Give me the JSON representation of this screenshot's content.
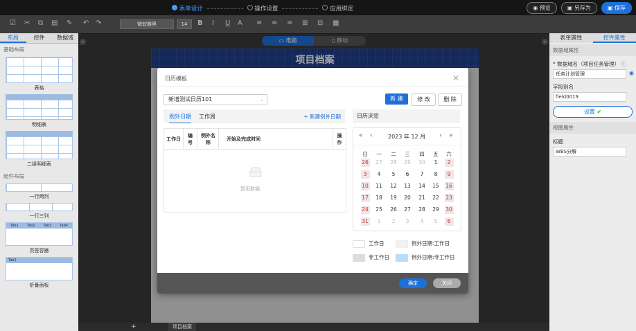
{
  "topbar": {
    "steps": [
      {
        "label": "表单设计",
        "active": true
      },
      {
        "label": "操作设置",
        "active": false
      },
      {
        "label": "应用绑定",
        "active": false
      }
    ],
    "preview_label": "预览",
    "save_as_label": "另存为",
    "save_label": "保存"
  },
  "toolbar": {
    "font_family": "微软雅黑",
    "font_size": "14",
    "bold": "B",
    "italic": "I",
    "underline": "U",
    "font_color": "A"
  },
  "left_panel": {
    "tabs": [
      "布局",
      "控件",
      "数据域"
    ],
    "basic_section": "基础布局",
    "items_basic": [
      "表格",
      "明细表",
      "二级明细表"
    ],
    "component_section": "组件布局",
    "items_component": [
      "一行两列",
      "一行三列",
      "页签容器",
      "折叠面板"
    ],
    "tab_thumb_labels": [
      "Tab1",
      "Tab2",
      "Tab3",
      "Tab4"
    ],
    "fold_thumb_label": "Tab1"
  },
  "canvas": {
    "tabs": [
      "电脑",
      "移动"
    ],
    "doc_title": "项目档案",
    "bottom_tab": "项目档案",
    "add_tab": "+"
  },
  "right_panel": {
    "tabs": [
      "表单属性",
      "控件属性"
    ],
    "data_section": "数据域属性",
    "domain_label": "* 数据域名（项目任务管理）",
    "domain_value": "任务计划管理",
    "alias_label": "字段别名",
    "alias_value": "field0019",
    "set_button": "设置",
    "view_section": "视图属性",
    "title_label": "标题",
    "title_value": "WBS分解"
  },
  "dialog": {
    "title": "日历模板",
    "calendar_select": "新增测试日历101",
    "new_button": "新 建",
    "edit_button": "修 改",
    "delete_button": "删 除",
    "tab_exception": "例外日期",
    "tab_workweek": "工作周",
    "add_exception": "+ 新建例外日期",
    "table_headers": [
      "工作日",
      "编号",
      "例外名称",
      "开始及完成时间",
      "操作"
    ],
    "empty_text": "暂无数据",
    "calendar_view_title": "日历浏览",
    "calendar_month": "2023 年 12 月",
    "weekdays": [
      "日",
      "一",
      "二",
      "三",
      "四",
      "五",
      "六"
    ],
    "weeks": [
      [
        "26",
        "27",
        "28",
        "29",
        "30",
        "1",
        "2"
      ],
      [
        "3",
        "4",
        "5",
        "6",
        "7",
        "8",
        "9"
      ],
      [
        "10",
        "11",
        "12",
        "13",
        "14",
        "15",
        "16"
      ],
      [
        "17",
        "18",
        "19",
        "20",
        "21",
        "22",
        "23"
      ],
      [
        "24",
        "25",
        "26",
        "27",
        "28",
        "29",
        "30"
      ],
      [
        "31",
        "1",
        "2",
        "3",
        "4",
        "5",
        "6"
      ]
    ],
    "legend": {
      "workday": "工作日",
      "exception_workday": "例外日期:工作日",
      "nonworkday": "非工作日",
      "exception_nonworkday": "例外日期:非工作日"
    },
    "ok_button": "确定",
    "close_button": "关闭"
  },
  "colors": {
    "accent": "#1e6fd9",
    "nonwork_bg": "#f3e5e5",
    "nonwork_text": "#c23030",
    "exception_nonwork": "#bcdcf7"
  }
}
